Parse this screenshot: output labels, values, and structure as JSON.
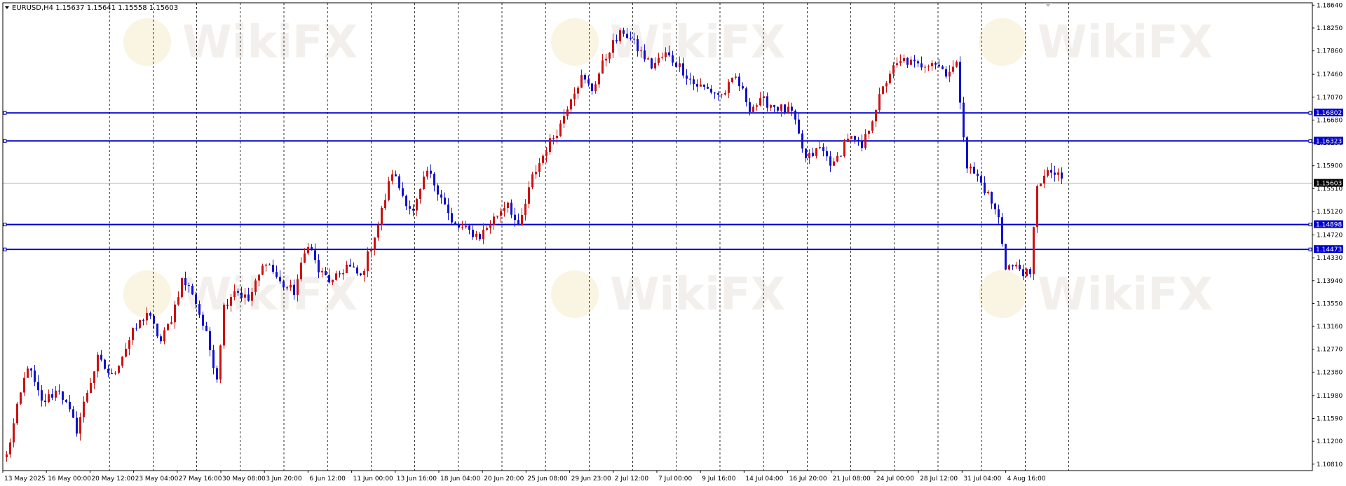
{
  "symbol_info": "EURUSD,H4  1.15637 1.15641 1.15558 1.15603",
  "watermark": "WikiFX",
  "chart_data": {
    "type": "candlestick",
    "symbol": "EURUSD",
    "timeframe": "H4",
    "ohlc_header": {
      "open": 1.15637,
      "high": 1.15641,
      "low": 1.15558,
      "close": 1.15603
    },
    "current_price": 1.15603,
    "ylim": [
      1.107,
      1.1868
    ],
    "y_ticks": [
      "1.18640",
      "1.18250",
      "1.17860",
      "1.17460",
      "1.17070",
      "1.16680",
      "1.16290",
      "1.15900",
      "1.15510",
      "1.15120",
      "1.14720",
      "1.14330",
      "1.13940",
      "1.13550",
      "1.13160",
      "1.12770",
      "1.12380",
      "1.11980",
      "1.11590",
      "1.11200",
      "1.10810"
    ],
    "x_ticks": [
      "13 May 2025",
      "16 May 00:00",
      "20 May 12:00",
      "23 May 04:00",
      "27 May 16:00",
      "30 May 08:00",
      "3 Jun 20:00",
      "6 Jun 12:00",
      "11 Jun 00:00",
      "13 Jun 16:00",
      "18 Jun 04:00",
      "20 Jun 20:00",
      "25 Jun 08:00",
      "29 Jun 23:00",
      "2 Jul 12:00",
      "7 Jul 00:00",
      "9 Jul 16:00",
      "14 Jul 04:00",
      "16 Jul 20:00",
      "21 Jul 08:00",
      "24 Jul 00:00",
      "28 Jul 12:00",
      "31 Jul 04:00",
      "4 Aug 16:00"
    ],
    "horizontal_levels": [
      {
        "label": "1.16802",
        "price": 1.16802
      },
      {
        "label": "1.16323",
        "price": 1.16323
      },
      {
        "label": "1.14898",
        "price": 1.14898
      },
      {
        "label": "1.14473",
        "price": 1.14473
      }
    ],
    "price_line_label": "1.15603",
    "anchors": [
      [
        0,
        1.1095
      ],
      [
        3,
        1.1175
      ],
      [
        6,
        1.125
      ],
      [
        10,
        1.1185
      ],
      [
        15,
        1.121
      ],
      [
        20,
        1.114
      ],
      [
        23,
        1.1205
      ],
      [
        26,
        1.126
      ],
      [
        30,
        1.123
      ],
      [
        36,
        1.1305
      ],
      [
        40,
        1.134
      ],
      [
        44,
        1.129
      ],
      [
        47,
        1.133
      ],
      [
        50,
        1.1395
      ],
      [
        53,
        1.1375
      ],
      [
        57,
        1.13
      ],
      [
        60,
        1.123
      ],
      [
        62,
        1.135
      ],
      [
        65,
        1.138
      ],
      [
        69,
        1.136
      ],
      [
        74,
        1.143
      ],
      [
        78,
        1.139
      ],
      [
        82,
        1.1375
      ],
      [
        86,
        1.146
      ],
      [
        89,
        1.141
      ],
      [
        93,
        1.139
      ],
      [
        97,
        1.142
      ],
      [
        101,
        1.14
      ],
      [
        106,
        1.149
      ],
      [
        110,
        1.158
      ],
      [
        113,
        1.154
      ],
      [
        116,
        1.151
      ],
      [
        120,
        1.158
      ],
      [
        124,
        1.154
      ],
      [
        127,
        1.149
      ],
      [
        131,
        1.148
      ],
      [
        135,
        1.147
      ],
      [
        139,
        1.15
      ],
      [
        143,
        1.153
      ],
      [
        146,
        1.148
      ],
      [
        150,
        1.157
      ],
      [
        154,
        1.162
      ],
      [
        158,
        1.166
      ],
      [
        161,
        1.171
      ],
      [
        164,
        1.174
      ],
      [
        167,
        1.172
      ],
      [
        172,
        1.179
      ],
      [
        176,
        1.182
      ],
      [
        180,
        1.179
      ],
      [
        184,
        1.176
      ],
      [
        188,
        1.178
      ],
      [
        192,
        1.176
      ],
      [
        196,
        1.173
      ],
      [
        200,
        1.172
      ],
      [
        204,
        1.171
      ],
      [
        208,
        1.174
      ],
      [
        212,
        1.169
      ],
      [
        216,
        1.17
      ],
      [
        220,
        1.169
      ],
      [
        224,
        1.168
      ],
      [
        228,
        1.16
      ],
      [
        232,
        1.162
      ],
      [
        236,
        1.159
      ],
      [
        240,
        1.164
      ],
      [
        244,
        1.162
      ],
      [
        248,
        1.169
      ],
      [
        252,
        1.175
      ],
      [
        256,
        1.177
      ],
      [
        260,
        1.176
      ],
      [
        264,
        1.177
      ],
      [
        268,
        1.175
      ],
      [
        271,
        1.176
      ],
      [
        274,
        1.159
      ],
      [
        277,
        1.157
      ],
      [
        280,
        1.154
      ],
      [
        283,
        1.15
      ],
      [
        285,
        1.142
      ],
      [
        289,
        1.1415
      ],
      [
        292,
        1.14
      ],
      [
        294,
        1.156
      ],
      [
        298,
        1.158
      ],
      [
        301,
        1.1565
      ]
    ]
  }
}
